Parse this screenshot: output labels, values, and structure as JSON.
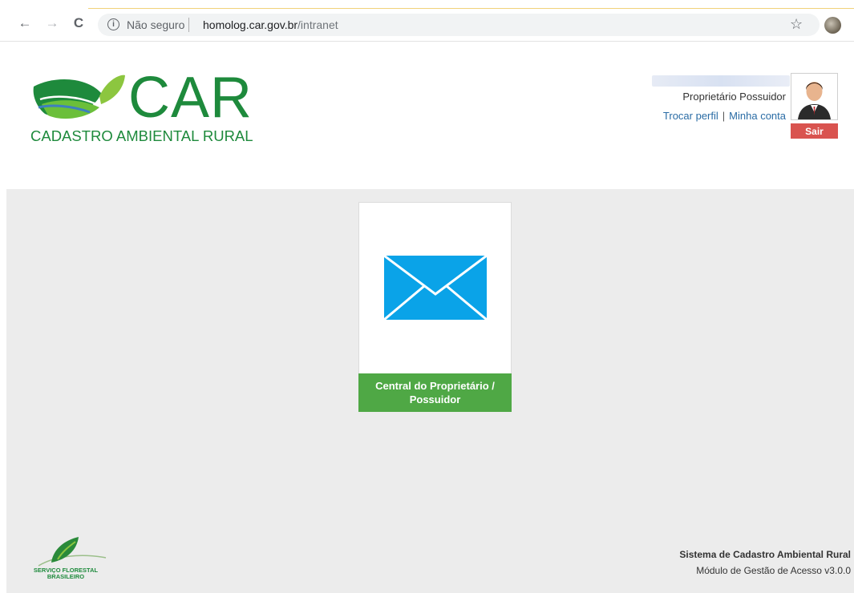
{
  "browser": {
    "security_label": "Não seguro",
    "url_host": "homolog.car.gov.br",
    "url_path": "/intranet",
    "info_glyph": "i",
    "back_icon": "←",
    "forward_icon": "→",
    "reload_icon": "C",
    "star_icon": "☆"
  },
  "header": {
    "logo_title": "CAR",
    "logo_subtitle": "CADASTRO AMBIENTAL RURAL",
    "brand_color": "#1e8a3c"
  },
  "user": {
    "role": "Proprietário Possuidor",
    "switch_profile_label": "Trocar perfil",
    "link_separator": "|",
    "my_account_label": "Minha conta",
    "logout_label": "Sair"
  },
  "main": {
    "cards": [
      {
        "label_line1": "Central do Proprietário /",
        "label_line2": "Possuidor",
        "icon": "envelope-icon",
        "accent": "#4fa845",
        "icon_color": "#0aa3e8"
      }
    ]
  },
  "footer": {
    "org_logo_line1": "SERVIÇO FLORESTAL",
    "org_logo_line2": "BRASILEIRO",
    "system_name": "Sistema de Cadastro Ambiental Rural",
    "module_version": "Módulo de Gestão de Acesso v3.0.0"
  }
}
